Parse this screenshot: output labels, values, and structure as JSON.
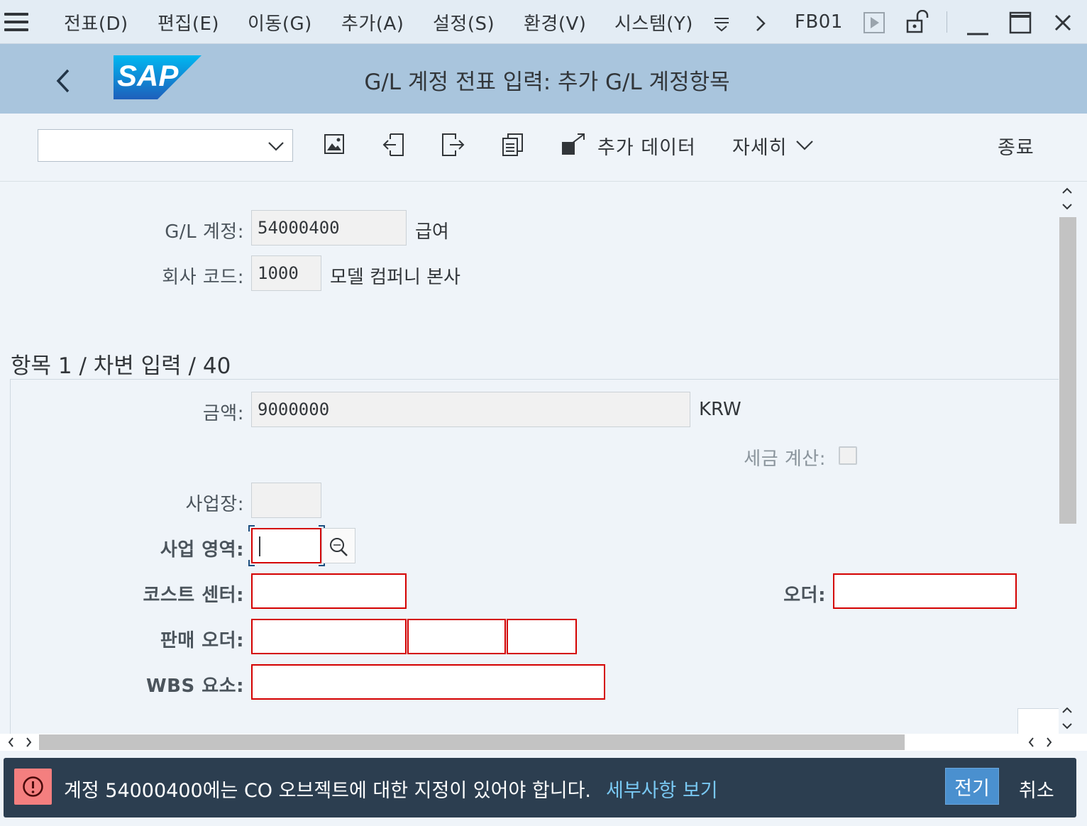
{
  "menu": {
    "items": [
      "전표(D)",
      "편집(E)",
      "이동(G)",
      "추가(A)",
      "설정(S)",
      "환경(V)",
      "시스템(Y)"
    ],
    "tcode": "FB01"
  },
  "header": {
    "title": "G/L 계정 전표 입력: 추가 G/L 계정항목",
    "logo_text": "SAP"
  },
  "toolbar": {
    "select_value": "",
    "more_data_label": "추가 데이터",
    "details_label": "자세히",
    "exit_label": "종료"
  },
  "form": {
    "gl_account_label": "G/L 계정:",
    "gl_account_value": "54000400",
    "gl_account_desc": "급여",
    "company_code_label": "회사 코드:",
    "company_code_value": "1000",
    "company_code_desc": "모델 컴퍼니 본사"
  },
  "item": {
    "section_title": "항목 1 / 차변 입력 / 40",
    "amount_label": "금액:",
    "amount_value": "9000000",
    "currency": "KRW",
    "tax_calc_label": "세금 계산:",
    "tax_calc_checked": false,
    "business_place_label": "사업장:",
    "business_place_value": "",
    "business_area_label": "사업 영역:",
    "business_area_value": "",
    "cost_center_label": "코스트 센터:",
    "cost_center_value": "",
    "order_label": "오더:",
    "order_value": "",
    "sales_order_label": "판매 오더:",
    "sales_order_values": [
      "",
      "",
      ""
    ],
    "wbs_label": "WBS 요소:",
    "wbs_value": ""
  },
  "status": {
    "message": "계정 54000400에는 CO 오브젝트에 대한 지정이 있어야 합니다.",
    "details_link": "세부사항 보기",
    "post_button": "전기",
    "cancel_button": "취소",
    "type": "error"
  },
  "colors": {
    "error_red": "#d40000",
    "title_bar": "#a9c5dd",
    "sap_blue": "#1a9ee0",
    "status_bg": "#2c3e50"
  }
}
